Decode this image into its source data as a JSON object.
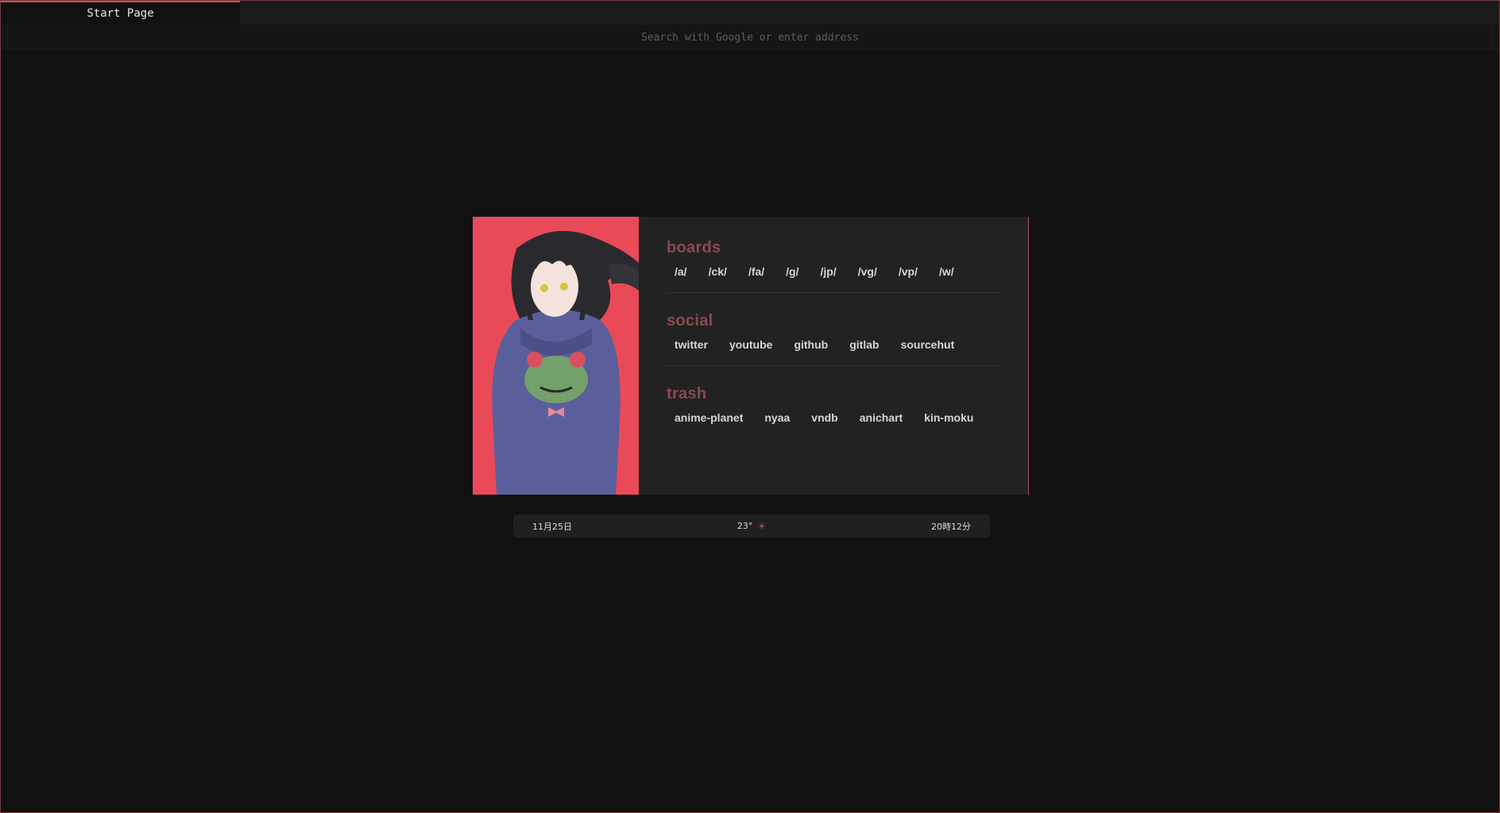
{
  "tabs": [
    {
      "label": "Start Page",
      "active": true
    }
  ],
  "address_bar": {
    "placeholder": "Search with Google or enter address",
    "value": ""
  },
  "sections": [
    {
      "title": "boards",
      "links": [
        "/a/",
        "/ck/",
        "/fa/",
        "/g/",
        "/jp/",
        "/vg/",
        "/vp/",
        "/w/"
      ]
    },
    {
      "title": "social",
      "links": [
        "twitter",
        "youtube",
        "github",
        "gitlab",
        "sourcehut"
      ]
    },
    {
      "title": "trash",
      "links": [
        "anime-planet",
        "nyaa",
        "vndb",
        "anichart",
        "kin-moku"
      ]
    }
  ],
  "status": {
    "date": "11月25日",
    "temperature": "23°",
    "weather_icon": "sun-icon",
    "time": "20時12分"
  },
  "colors": {
    "background": "#121112",
    "card": "#232223",
    "accent": "#8a4a50",
    "art_background": "#ea4a58"
  }
}
